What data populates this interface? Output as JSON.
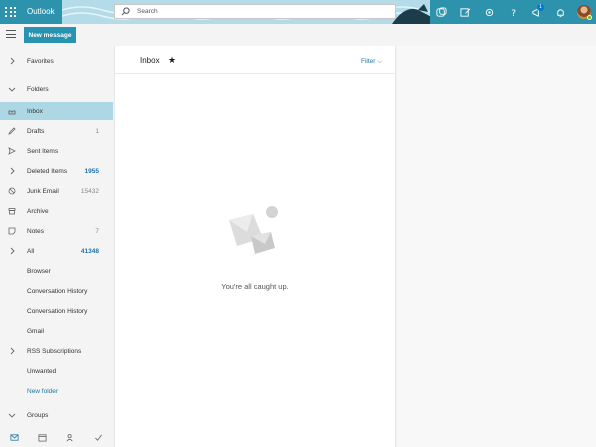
{
  "topbar": {
    "app_name": "Outlook",
    "search_placeholder": "Search",
    "notification_count": "1"
  },
  "toolbar": {
    "new_message_label": "New message"
  },
  "sidebar": {
    "favorites_label": "Favorites",
    "folders_label": "Folders",
    "groups_label": "Groups",
    "items": [
      {
        "label": "Inbox",
        "count": "",
        "icon": "inbox-icon"
      },
      {
        "label": "Drafts",
        "count": "1",
        "icon": "pencil-icon"
      },
      {
        "label": "Sent Items",
        "count": "",
        "icon": "send-icon"
      },
      {
        "label": "Deleted Items",
        "count": "1955",
        "icon": "chevron-right-icon"
      },
      {
        "label": "Junk Email",
        "count": "15432",
        "icon": "block-icon"
      },
      {
        "label": "Archive",
        "count": "",
        "icon": "archive-icon"
      },
      {
        "label": "Notes",
        "count": "7",
        "icon": "note-icon"
      },
      {
        "label": "All",
        "count": "41348",
        "icon": "chevron-right-icon"
      },
      {
        "label": "Browser",
        "count": ""
      },
      {
        "label": "Conversation History",
        "count": ""
      },
      {
        "label": "Conversation History",
        "count": ""
      },
      {
        "label": "Gmail",
        "count": ""
      },
      {
        "label": "RSS Subscriptions",
        "count": "",
        "icon": "chevron-right-icon"
      },
      {
        "label": "Unwanted",
        "count": ""
      },
      {
        "label": "New folder",
        "count": ""
      }
    ]
  },
  "main": {
    "title": "Inbox",
    "filter_label": "Filter",
    "empty_message": "You're all caught up."
  },
  "colors": {
    "accent": "#2793b0",
    "selected": "#add7e4",
    "link": "#2176a6"
  }
}
